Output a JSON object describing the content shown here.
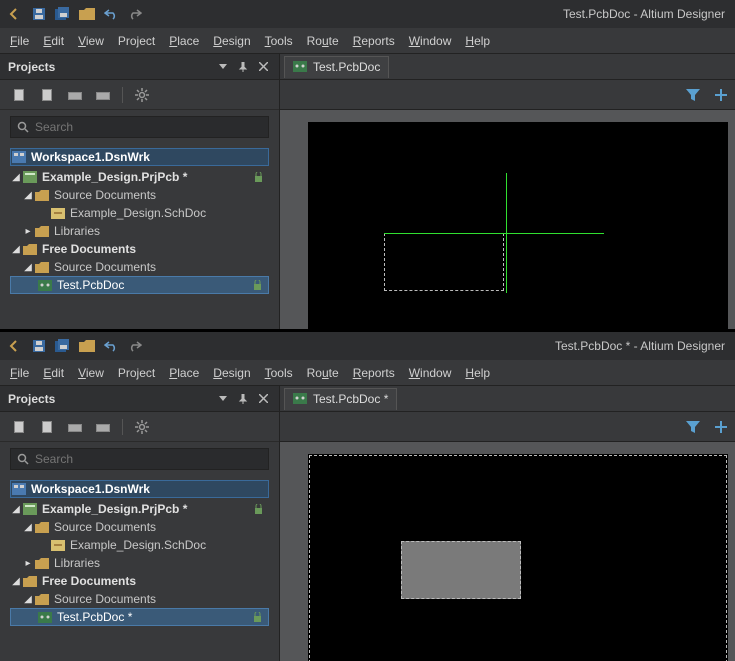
{
  "instances": [
    {
      "title": "Test.PcbDoc - Altium Designer",
      "doc_tab": "Test.PcbDoc",
      "pcb_selected": "Test.PcbDoc",
      "canvas_mode": "origin"
    },
    {
      "title": "Test.PcbDoc * - Altium Designer",
      "doc_tab": "Test.PcbDoc *",
      "pcb_selected": "Test.PcbDoc *",
      "canvas_mode": "placed"
    }
  ],
  "menu": {
    "file": "File",
    "edit": "Edit",
    "view": "View",
    "project": "Project",
    "place": "Place",
    "design": "Design",
    "tools": "Tools",
    "route": "Route",
    "reports": "Reports",
    "window": "Window",
    "help": "Help"
  },
  "panel": {
    "title": "Projects",
    "search_placeholder": "Search"
  },
  "tree": {
    "workspace": "Workspace1.DsnWrk",
    "project": "Example_Design.PrjPcb *",
    "source_docs": "Source Documents",
    "schdoc": "Example_Design.SchDoc",
    "libraries": "Libraries",
    "free_docs": "Free Documents",
    "source_docs2": "Source Documents"
  }
}
